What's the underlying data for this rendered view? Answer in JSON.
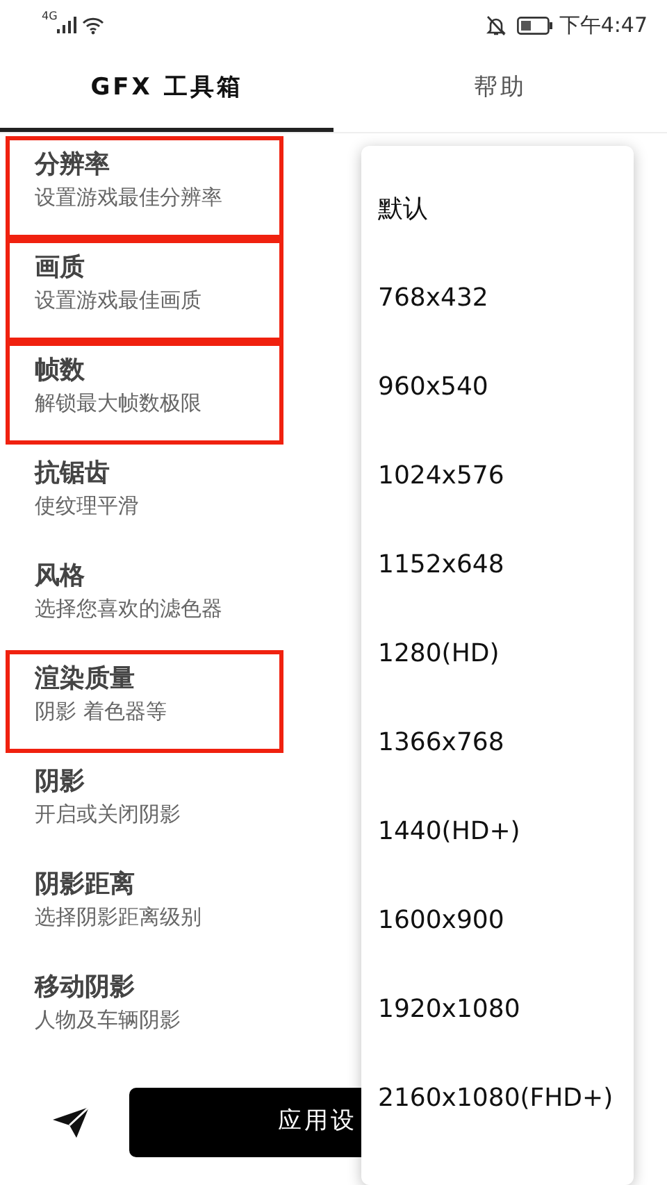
{
  "status_bar": {
    "network": "4G",
    "time": "下午4:47"
  },
  "tabs": [
    {
      "label": "GFX 工具箱",
      "selected": true
    },
    {
      "label": "帮助",
      "selected": false
    }
  ],
  "settings": [
    {
      "title": "分辨率",
      "subtitle": "设置游戏最佳分辨率",
      "highlighted": true
    },
    {
      "title": "画质",
      "subtitle": "设置游戏最佳画质",
      "highlighted": true
    },
    {
      "title": "帧数",
      "subtitle": "解锁最大帧数极限",
      "highlighted": true
    },
    {
      "title": "抗锯齿",
      "subtitle": "使纹理平滑",
      "highlighted": false
    },
    {
      "title": "风格",
      "subtitle": "选择您喜欢的滤色器",
      "highlighted": false
    },
    {
      "title": "渲染质量",
      "subtitle": "阴影 着色器等",
      "highlighted": true
    },
    {
      "title": "阴影",
      "subtitle": "开启或关闭阴影",
      "highlighted": false
    },
    {
      "title": "阴影距离",
      "subtitle": "选择阴影距离级别",
      "highlighted": false
    },
    {
      "title": "移动阴影",
      "subtitle": "人物及车辆阴影",
      "highlighted": false
    }
  ],
  "apply_button": {
    "label": "应用设"
  },
  "dropdown": {
    "options": [
      "默认",
      "768x432",
      "960x540",
      "1024x576",
      "1152x648",
      "1280(HD)",
      "1366x768",
      "1440(HD+)",
      "1600x900",
      "1920x1080",
      "2160x1080(FHD+)"
    ]
  }
}
